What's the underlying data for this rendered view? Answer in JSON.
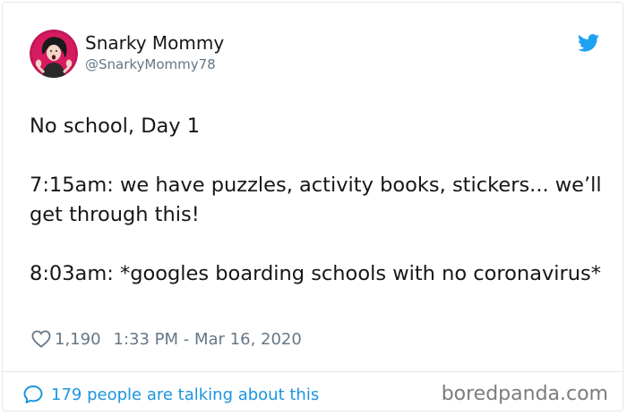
{
  "author": {
    "name": "Snarky Mommy",
    "handle": "@SnarkyMommy78"
  },
  "tweet": {
    "lines": [
      "No school, Day 1",
      "7:15am: we have puzzles, activity books, stickers... we’ll get through this!",
      "8:03am: *googles boarding schools with no coronavirus*"
    ]
  },
  "meta": {
    "likes": "1,190",
    "timestamp": "1:33 PM - Mar 16, 2020"
  },
  "footer": {
    "talking": "179 people are talking about this"
  },
  "watermark": "boredpanda.com",
  "colors": {
    "text": "#14171a",
    "muted": "#657786",
    "twitter_blue": "#1da1f2",
    "link_blue": "#1b95e0",
    "avatar_bg": "#c2185b"
  },
  "icons": {
    "brand": "twitter-bird-icon",
    "like": "heart-icon",
    "replies": "speech-bubble-icon"
  }
}
